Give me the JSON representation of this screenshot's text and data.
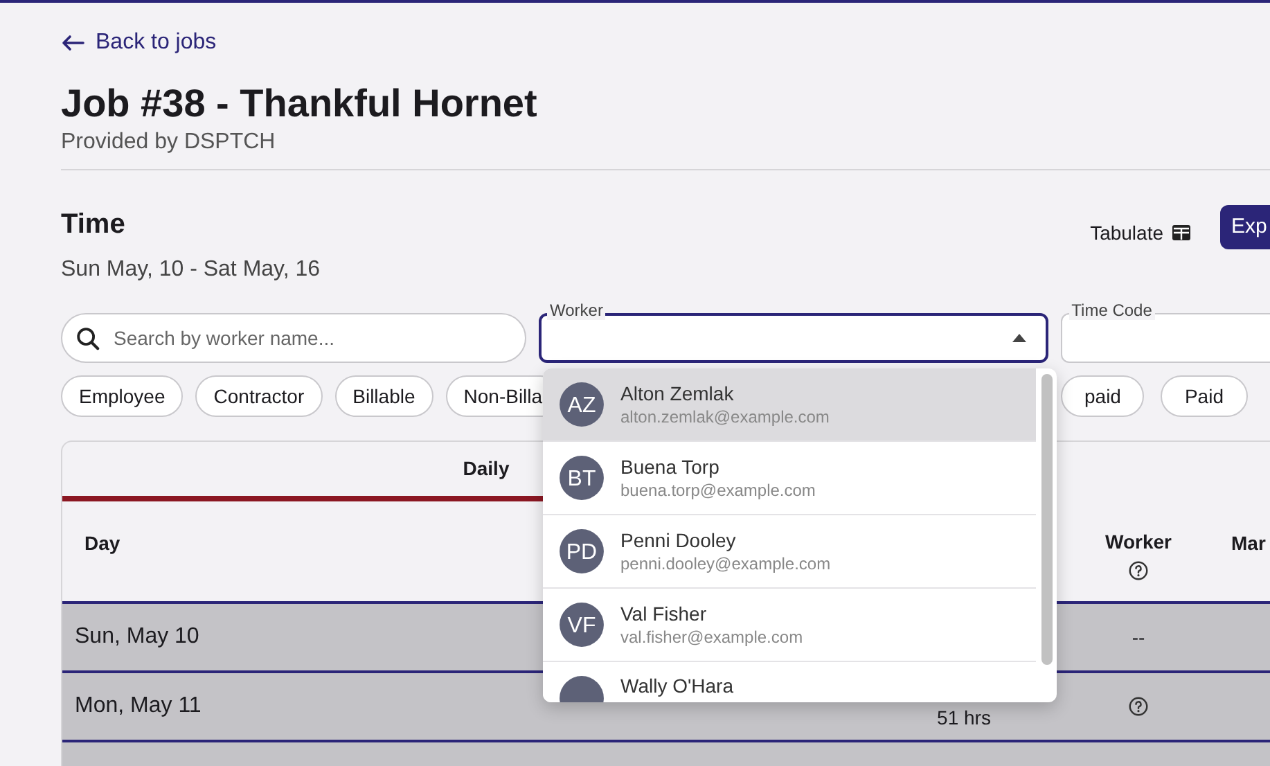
{
  "back_link": {
    "label": "Back to jobs"
  },
  "header": {
    "title": "Job #38 - Thankful Hornet",
    "subtitle": "Provided by DSPTCH"
  },
  "section": {
    "title": "Time",
    "date_range": "Sun May, 10 - Sat May, 16"
  },
  "toolbar": {
    "tabulate": "Tabulate",
    "export": "Exp"
  },
  "filters": {
    "search": {
      "placeholder": "Search by worker name..."
    },
    "worker": {
      "label": "Worker",
      "expanded": true
    },
    "time_code": {
      "label": "Time Code"
    }
  },
  "chips": {
    "left": [
      "Employee",
      "Contractor",
      "Billable",
      "Non-Billa"
    ],
    "right": [
      "paid",
      "Paid"
    ]
  },
  "worker_dropdown": [
    {
      "initials": "AZ",
      "name": "Alton Zemlak",
      "email": "alton.zemlak@example.com",
      "selected": true
    },
    {
      "initials": "BT",
      "name": "Buena Torp",
      "email": "buena.torp@example.com",
      "selected": false
    },
    {
      "initials": "PD",
      "name": "Penni Dooley",
      "email": "penni.dooley@example.com",
      "selected": false
    },
    {
      "initials": "VF",
      "name": "Val Fisher",
      "email": "val.fisher@example.com",
      "selected": false
    },
    {
      "name": "Wally O'Hara",
      "selected": false
    }
  ],
  "table": {
    "tabs": [
      {
        "label": "Daily",
        "selected": true
      }
    ],
    "columns": [
      "Day",
      "Worker",
      "Mar"
    ],
    "rows": [
      {
        "day": "Sun, May 10",
        "worker": {
          "kind": "text",
          "text": "--"
        }
      },
      {
        "day": "Mon, May 11",
        "hours": "51 hrs",
        "worker": {
          "kind": "help"
        }
      }
    ]
  }
}
